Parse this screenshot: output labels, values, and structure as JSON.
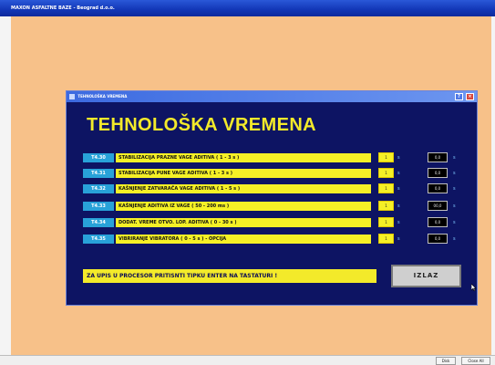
{
  "app": {
    "title": "MAXON ASFALTNE BAZE - Beograd d.o.o."
  },
  "dialog": {
    "titlebar": "TEHNOLOŠKA VREMENA",
    "heading": "TEHNOLOŠKA VREMENA",
    "rows": [
      {
        "code": "T4.30",
        "label": "STABILIZACIJA PRAZNE VAGE ADITIVA  ( 1 - 3 s )",
        "value": "1",
        "unit": "s",
        "readout": "0,0",
        "readout_unit": "s"
      },
      {
        "code": "T4.31",
        "label": "STABILIZACIJA PUNE VAGE ADITIVA  ( 1 - 3 s )",
        "value": "1",
        "unit": "s",
        "readout": "0,0",
        "readout_unit": "s"
      },
      {
        "code": "T4.32",
        "label": "KAŠNJENJE ZATVARAČA VAGE ADITIVA  ( 1 - 5 s )",
        "value": "1",
        "unit": "s",
        "readout": "0,0",
        "readout_unit": "s"
      },
      {
        "code": "T4.33",
        "label": "KAŠNJENJE ADITIVA IZ VAGE  ( 50 - 200 ms )",
        "value": "1",
        "unit": "s",
        "readout": "00,0",
        "readout_unit": "s"
      },
      {
        "code": "T4.34",
        "label": "DODAT. VREME OTVO. LOP. ADITIVA  ( 0 - 30 s )",
        "value": "1",
        "unit": "s",
        "readout": "0,0",
        "readout_unit": "s"
      },
      {
        "code": "T4.35",
        "label": "VIBRIRANJE VIBRATORA  ( 0 - 5 s )  - OPCIJA",
        "value": "1",
        "unit": "s",
        "readout": "0,0",
        "readout_unit": "s"
      }
    ],
    "notice": "ZA UPIS U PROCESOR PRITISNTI TIPKU ENTER NA TASTATURI !",
    "exit_label": "IZLAZ"
  },
  "taskbar": {
    "btn1": "Disk",
    "btn2": "Close All"
  }
}
